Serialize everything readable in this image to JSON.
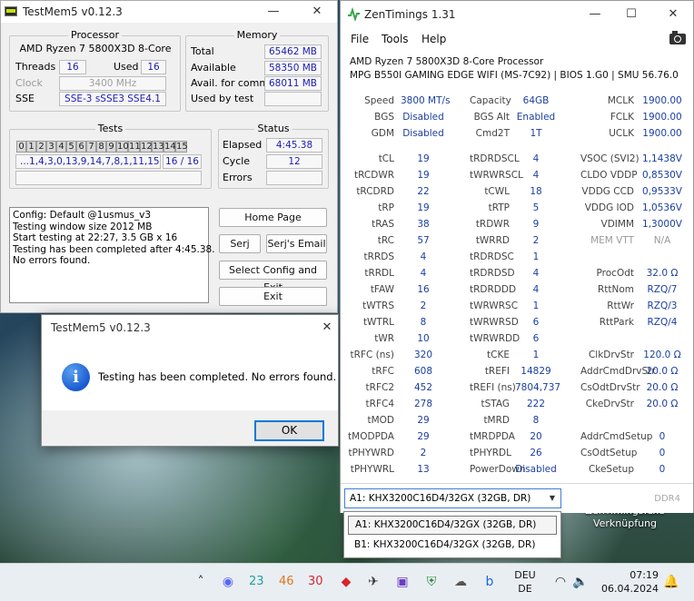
{
  "desktop": {
    "shortcut_line1": "ZenTimings.exe",
    "shortcut_line2": "Verknüpfung"
  },
  "testmem": {
    "title": "TestMem5 v0.12.3",
    "processor": {
      "heading": "Processor",
      "name": "AMD Ryzen 7 5800X3D 8-Core",
      "threads_label": "Threads",
      "threads": "16",
      "used_label": "Used",
      "used": "16",
      "clock_label": "Clock",
      "clock": "3400 MHz",
      "sse_label": "SSE",
      "sse": "SSE-3 sSSE3 SSE4.1"
    },
    "memory": {
      "heading": "Memory",
      "total_label": "Total",
      "total": "65462 MB",
      "available_label": "Available",
      "available": "58350 MB",
      "commit_label": "Avail. for commit",
      "commit": "68011 MB",
      "usedbytest_label": "Used by test",
      "usedbytest": ""
    },
    "tests": {
      "heading": "Tests",
      "numbers": [
        "0",
        "1",
        "2",
        "3",
        "4",
        "5",
        "6",
        "7",
        "8",
        "9",
        "10",
        "11",
        "12",
        "13",
        "14",
        "15"
      ],
      "sequence": "...1,4,3,0,13,9,14,7,8,1,11,15",
      "progress": "16 / 16"
    },
    "status": {
      "heading": "Status",
      "elapsed_label": "Elapsed",
      "elapsed": "4:45.38",
      "cycle_label": "Cycle",
      "cycle": "12",
      "errors_label": "Errors",
      "errors": ""
    },
    "log": [
      "Config: Default @1usmus_v3",
      "Testing window size 2012 MB",
      "Start testing at 22:27, 3.5 GB x 16",
      "Testing has been completed after 4:45.38.",
      "No errors found."
    ],
    "buttons": {
      "home": "Home Page",
      "serj": "Serj",
      "serj_email": "Serj's Email",
      "select_config": "Select Config and Exit",
      "exit": "Exit"
    }
  },
  "dialog": {
    "title": "TestMem5 v0.12.3",
    "message": "Testing has been completed. No errors found.",
    "ok": "OK"
  },
  "zentimings": {
    "title": "ZenTimings 1.31",
    "menu": [
      "File",
      "Tools",
      "Help"
    ],
    "cpu": "AMD Ryzen 7 5800X3D 8-Core Processor",
    "board": "MPG B550I GAMING EDGE WIFI (MS-7C92) | BIOS 1.G0 | SMU 56.76.0",
    "top_rows": [
      [
        {
          "l": "Speed",
          "v": "3800 MT/s"
        },
        {
          "l": "Capacity",
          "v": "64GB"
        },
        {
          "l": "MCLK",
          "v": "1900.00"
        }
      ],
      [
        {
          "l": "BGS",
          "v": "Disabled"
        },
        {
          "l": "BGS Alt",
          "v": "Enabled"
        },
        {
          "l": "FCLK",
          "v": "1900.00"
        }
      ],
      [
        {
          "l": "GDM",
          "v": "Disabled"
        },
        {
          "l": "Cmd2T",
          "v": "1T"
        },
        {
          "l": "UCLK",
          "v": "1900.00"
        }
      ]
    ],
    "rows": [
      [
        {
          "l": "tCL",
          "v": "19"
        },
        {
          "l": "tRDRDSCL",
          "v": "4"
        },
        {
          "l": "VSOC (SVI2)",
          "v": "1,1438V"
        }
      ],
      [
        {
          "l": "tRCDWR",
          "v": "19"
        },
        {
          "l": "tWRWRSCL",
          "v": "4"
        },
        {
          "l": "CLDO VDDP",
          "v": "0,8530V"
        }
      ],
      [
        {
          "l": "tRCDRD",
          "v": "22"
        },
        {
          "l": "tCWL",
          "v": "18"
        },
        {
          "l": "VDDG CCD",
          "v": "0,9533V"
        }
      ],
      [
        {
          "l": "tRP",
          "v": "19"
        },
        {
          "l": "tRTP",
          "v": "5"
        },
        {
          "l": "VDDG IOD",
          "v": "1,0536V"
        }
      ],
      [
        {
          "l": "tRAS",
          "v": "38"
        },
        {
          "l": "tRDWR",
          "v": "9"
        },
        {
          "l": "VDIMM",
          "v": "1,3000V"
        }
      ],
      [
        {
          "l": "tRC",
          "v": "57"
        },
        {
          "l": "tWRRD",
          "v": "2"
        },
        {
          "l": "MEM VTT",
          "v": "N/A",
          "dis": true
        }
      ],
      [
        {
          "l": "tRRDS",
          "v": "4"
        },
        {
          "l": "tRDRDSC",
          "v": "1"
        },
        {
          "l": "",
          "v": ""
        }
      ],
      [
        {
          "l": "tRRDL",
          "v": "4"
        },
        {
          "l": "tRDRDSD",
          "v": "4"
        },
        {
          "l": "ProcOdt",
          "v": "32.0 Ω"
        }
      ],
      [
        {
          "l": "tFAW",
          "v": "16"
        },
        {
          "l": "tRDRDDD",
          "v": "4"
        },
        {
          "l": "RttNom",
          "v": "RZQ/7"
        }
      ],
      [
        {
          "l": "tWTRS",
          "v": "2"
        },
        {
          "l": "tWRWRSC",
          "v": "1"
        },
        {
          "l": "RttWr",
          "v": "RZQ/3"
        }
      ],
      [
        {
          "l": "tWTRL",
          "v": "8"
        },
        {
          "l": "tWRWRSD",
          "v": "6"
        },
        {
          "l": "RttPark",
          "v": "RZQ/4"
        }
      ],
      [
        {
          "l": "tWR",
          "v": "10"
        },
        {
          "l": "tWRWRDD",
          "v": "6"
        },
        {
          "l": "",
          "v": ""
        }
      ],
      [
        {
          "l": "tRFC (ns)",
          "v": "320"
        },
        {
          "l": "tCKE",
          "v": "1"
        },
        {
          "l": "ClkDrvStr",
          "v": "120.0 Ω"
        }
      ],
      [
        {
          "l": "tRFC",
          "v": "608"
        },
        {
          "l": "tREFI",
          "v": "14829"
        },
        {
          "l": "AddrCmdDrvStr",
          "v": "20.0 Ω"
        }
      ],
      [
        {
          "l": "tRFC2",
          "v": "452"
        },
        {
          "l": "tREFI (ns)",
          "v": "7804,737"
        },
        {
          "l": "CsOdtDrvStr",
          "v": "20.0 Ω"
        }
      ],
      [
        {
          "l": "tRFC4",
          "v": "278"
        },
        {
          "l": "tSTAG",
          "v": "222"
        },
        {
          "l": "CkeDrvStr",
          "v": "20.0 Ω"
        }
      ],
      [
        {
          "l": "tMOD",
          "v": "29"
        },
        {
          "l": "tMRD",
          "v": "8"
        },
        {
          "l": "",
          "v": ""
        }
      ],
      [
        {
          "l": "tMODPDA",
          "v": "29"
        },
        {
          "l": "tMRDPDA",
          "v": "20"
        },
        {
          "l": "AddrCmdSetup",
          "v": "0"
        }
      ],
      [
        {
          "l": "tPHYWRD",
          "v": "2"
        },
        {
          "l": "tPHYRDL",
          "v": "26"
        },
        {
          "l": "CsOdtSetup",
          "v": "0"
        }
      ],
      [
        {
          "l": "tPHYWRL",
          "v": "13"
        },
        {
          "l": "PowerDown",
          "v": "Disabled"
        },
        {
          "l": "CkeSetup",
          "v": "0"
        }
      ]
    ],
    "dimm_selected": "A1: KHX3200C16D4/32GX (32GB, DR)",
    "dimm_options": [
      "A1: KHX3200C16D4/32GX (32GB, DR)",
      "B1: KHX3200C16D4/32GX (32GB, DR)"
    ],
    "ddr": "DDR4"
  },
  "taskbar": {
    "counters": [
      {
        "value": "23",
        "color": "#1aa39a"
      },
      {
        "value": "46",
        "color": "#e0761c"
      },
      {
        "value": "30",
        "color": "#d8252b"
      }
    ],
    "lang1": "DEU",
    "lang2": "DE",
    "time": "07:19",
    "date": "06.04.2024"
  }
}
